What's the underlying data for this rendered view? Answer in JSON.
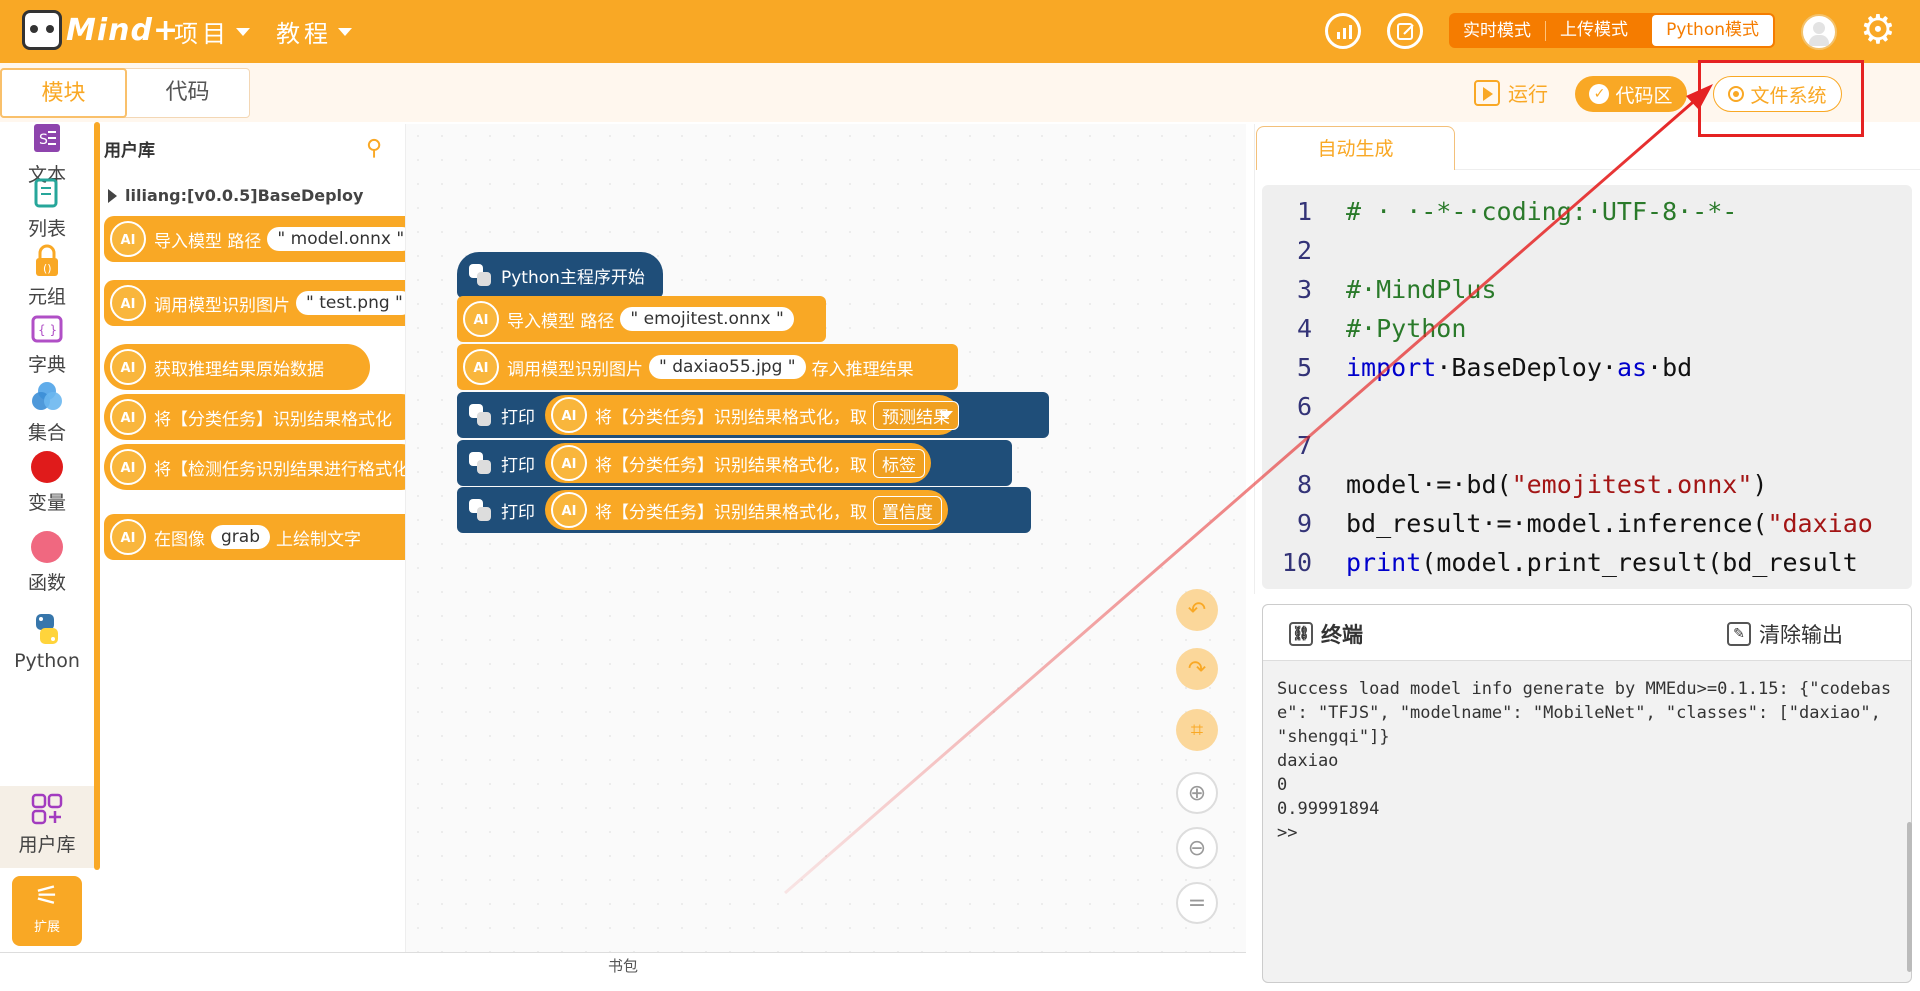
{
  "header": {
    "brand": "Mind+",
    "menu": [
      {
        "label": "项目"
      },
      {
        "label": "教程"
      }
    ],
    "modes": [
      "实时模式",
      "上传模式",
      "Python模式"
    ],
    "active_mode": "Python模式"
  },
  "tabs": {
    "blocks": "模块",
    "code": "代码"
  },
  "toolbar": {
    "run": "运行",
    "code_area": "代码区",
    "file_system": "文件系统"
  },
  "sidebar": {
    "categories": [
      {
        "label": "文本",
        "icon": "text-icon"
      },
      {
        "label": "列表",
        "icon": "list-icon"
      },
      {
        "label": "元组",
        "icon": "tuple-icon"
      },
      {
        "label": "字典",
        "icon": "dict-icon"
      },
      {
        "label": "集合",
        "icon": "set-icon"
      },
      {
        "label": "变量",
        "icon": "variable-dot"
      },
      {
        "label": "函数",
        "icon": "function-dot"
      },
      {
        "label": "Python",
        "icon": "python-icon"
      },
      {
        "label": "用户库",
        "icon": "user-lib-icon"
      }
    ],
    "extend": "扩展"
  },
  "palette": {
    "title": "用户库",
    "library": "liliang:[v0.0.5]BaseDeploy",
    "blocks": [
      {
        "text": "导入模型 路径",
        "arg": "\" model.onnx \""
      },
      {
        "text": "调用模型识别图片",
        "arg": "\" test.png \""
      },
      {
        "text": "获取推理结果原始数据",
        "arg": ""
      },
      {
        "text": "将【分类任务】识别结果格式化",
        "arg": ""
      },
      {
        "text": "将【检测任务识别结果进行格式化",
        "arg": ""
      },
      {
        "text": "在图像",
        "arg": "grab",
        "suffix": "上绘制文字"
      }
    ]
  },
  "workspace": {
    "hat": "Python主程序开始",
    "import": {
      "text": "导入模型 路径",
      "arg": "\" emojitest.onnx \""
    },
    "infer": {
      "text": "调用模型识别图片",
      "arg": "\" daxiao55.jpg \"",
      "suffix": "存入推理结果"
    },
    "prints": [
      {
        "label": "打印",
        "text": "将【分类任务】识别结果格式化，取",
        "option": "预测结果"
      },
      {
        "label": "打印",
        "text": "将【分类任务】识别结果格式化，取",
        "option": "标签"
      },
      {
        "label": "打印",
        "text": "将【分类任务】识别结果格式化，取",
        "option": "置信度"
      }
    ]
  },
  "backpack": "书包",
  "code": {
    "tab": "自动生成",
    "lines": [
      {
        "n": "1",
        "parts": [
          {
            "t": "# · ·-*-·coding:·UTF-8·-*-",
            "c": "cm"
          }
        ]
      },
      {
        "n": "2",
        "parts": []
      },
      {
        "n": "3",
        "parts": [
          {
            "t": "#·MindPlus",
            "c": "cm"
          }
        ]
      },
      {
        "n": "4",
        "parts": [
          {
            "t": "#·Python",
            "c": "cm"
          }
        ]
      },
      {
        "n": "5",
        "parts": [
          {
            "t": "import",
            "c": "kw"
          },
          {
            "t": "·BaseDeploy·",
            "c": "tx"
          },
          {
            "t": "as",
            "c": "kw"
          },
          {
            "t": "·bd",
            "c": "tx"
          }
        ]
      },
      {
        "n": "6",
        "parts": []
      },
      {
        "n": "7",
        "parts": []
      },
      {
        "n": "8",
        "parts": [
          {
            "t": "model·=·bd(",
            "c": "tx"
          },
          {
            "t": "\"emojitest.onnx\"",
            "c": "st"
          },
          {
            "t": ")",
            "c": "tx"
          }
        ]
      },
      {
        "n": "9",
        "parts": [
          {
            "t": "bd_result·=·model.inference(",
            "c": "tx"
          },
          {
            "t": "\"daxiao",
            "c": "st"
          }
        ]
      },
      {
        "n": "10",
        "parts": [
          {
            "t": "print",
            "c": "kw"
          },
          {
            "t": "(model.print_result(bd_result",
            "c": "tx"
          }
        ]
      }
    ]
  },
  "terminal": {
    "title": "终端",
    "clear": "清除输出",
    "lines": [
      "Success load model info generate by MMEdu>=0.1.15: {\"codebase\": \"TFJS\", \"modelname\": \"MobileNet\", \"classes\": [\"daxiao\", \"shengqi\"]}",
      "daxiao",
      "0",
      "0.99991894",
      ">>"
    ]
  },
  "colors": {
    "accent": "#f9a825",
    "dark_block": "#1f4e79",
    "annotation": "#e52222"
  }
}
